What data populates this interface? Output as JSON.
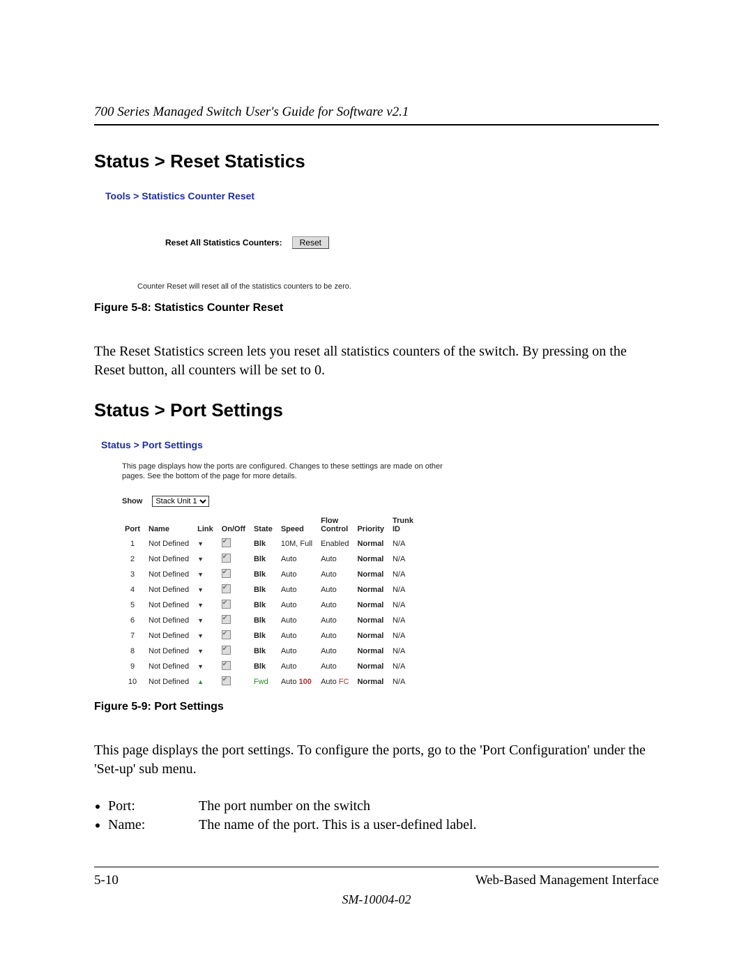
{
  "header": {
    "running_title": "700 Series Managed Switch User's Guide for Software v2.1"
  },
  "section1": {
    "heading": "Status > Reset Statistics",
    "screenshot": {
      "breadcrumb": "Tools > Statistics Counter Reset",
      "reset_label": "Reset All Statistics Counters:",
      "reset_button": "Reset",
      "desc": "Counter Reset will reset all of the statistics counters to be zero."
    },
    "figure_caption": "Figure 5-8:  Statistics Counter Reset",
    "body": "The Reset Statistics screen lets you reset all statistics counters of the switch. By pressing on the Reset button, all counters will be set to 0."
  },
  "section2": {
    "heading": "Status > Port Settings",
    "screenshot": {
      "breadcrumb": "Status > Port Settings",
      "intro": "This page displays how the ports are configured. Changes to these settings are made on other pages. See the bottom of the page for more details.",
      "show_label": "Show",
      "show_value": "Stack Unit 1",
      "columns": {
        "port": "Port",
        "name": "Name",
        "link": "Link",
        "onoff": "On/Off",
        "state": "State",
        "speed": "Speed",
        "flowcontrol1": "Flow",
        "flowcontrol2": "Control",
        "priority": "Priority",
        "trunk1": "Trunk",
        "trunk2": "ID"
      },
      "rows": [
        {
          "port": "1",
          "name": "Not Defined",
          "link": "down",
          "onoff": true,
          "state": "Blk",
          "state_cls": "bold",
          "speed": "10M, Full",
          "speed_cls": "",
          "fc": "Enabled",
          "fc_cls": "",
          "priority": "Normal",
          "trunk": "N/A"
        },
        {
          "port": "2",
          "name": "Not Defined",
          "link": "down",
          "onoff": true,
          "state": "Blk",
          "state_cls": "bold",
          "speed": "Auto",
          "speed_cls": "",
          "fc": "Auto",
          "fc_cls": "",
          "priority": "Normal",
          "trunk": "N/A"
        },
        {
          "port": "3",
          "name": "Not Defined",
          "link": "down",
          "onoff": true,
          "state": "Blk",
          "state_cls": "bold",
          "speed": "Auto",
          "speed_cls": "",
          "fc": "Auto",
          "fc_cls": "",
          "priority": "Normal",
          "trunk": "N/A"
        },
        {
          "port": "4",
          "name": "Not Defined",
          "link": "down",
          "onoff": true,
          "state": "Blk",
          "state_cls": "bold",
          "speed": "Auto",
          "speed_cls": "",
          "fc": "Auto",
          "fc_cls": "",
          "priority": "Normal",
          "trunk": "N/A"
        },
        {
          "port": "5",
          "name": "Not Defined",
          "link": "down",
          "onoff": true,
          "state": "Blk",
          "state_cls": "bold",
          "speed": "Auto",
          "speed_cls": "",
          "fc": "Auto",
          "fc_cls": "",
          "priority": "Normal",
          "trunk": "N/A"
        },
        {
          "port": "6",
          "name": "Not Defined",
          "link": "down",
          "onoff": true,
          "state": "Blk",
          "state_cls": "bold",
          "speed": "Auto",
          "speed_cls": "",
          "fc": "Auto",
          "fc_cls": "",
          "priority": "Normal",
          "trunk": "N/A"
        },
        {
          "port": "7",
          "name": "Not Defined",
          "link": "down",
          "onoff": true,
          "state": "Blk",
          "state_cls": "bold",
          "speed": "Auto",
          "speed_cls": "",
          "fc": "Auto",
          "fc_cls": "",
          "priority": "Normal",
          "trunk": "N/A"
        },
        {
          "port": "8",
          "name": "Not Defined",
          "link": "down",
          "onoff": true,
          "state": "Blk",
          "state_cls": "bold",
          "speed": "Auto",
          "speed_cls": "",
          "fc": "Auto",
          "fc_cls": "",
          "priority": "Normal",
          "trunk": "N/A"
        },
        {
          "port": "9",
          "name": "Not Defined",
          "link": "down",
          "onoff": true,
          "state": "Blk",
          "state_cls": "bold",
          "speed": "Auto",
          "speed_cls": "",
          "fc": "Auto",
          "fc_cls": "",
          "priority": "Normal",
          "trunk": "N/A"
        },
        {
          "port": "10",
          "name": "Not Defined",
          "link": "up",
          "onoff": true,
          "state": "Fwd",
          "state_cls": "green",
          "speed_pre": "Auto ",
          "speed": "100",
          "speed_cls": "red",
          "fc_pre": "Auto ",
          "fc": "FC",
          "fc_cls": "redplain",
          "priority": "Normal",
          "trunk": "N/A"
        }
      ]
    },
    "figure_caption": "Figure 5-9:  Port Settings",
    "body": "This page displays the port settings. To configure the ports, go to the 'Port Configuration' under the  'Set-up' sub menu.",
    "fields": [
      {
        "term": "Port:",
        "desc": "The port number on the switch"
      },
      {
        "term": "Name:",
        "desc": "The name of the port.   This is a user-defined label."
      }
    ]
  },
  "footer": {
    "page": "5-10",
    "title": "Web-Based Management Interface",
    "docnum": "SM-10004-02"
  }
}
